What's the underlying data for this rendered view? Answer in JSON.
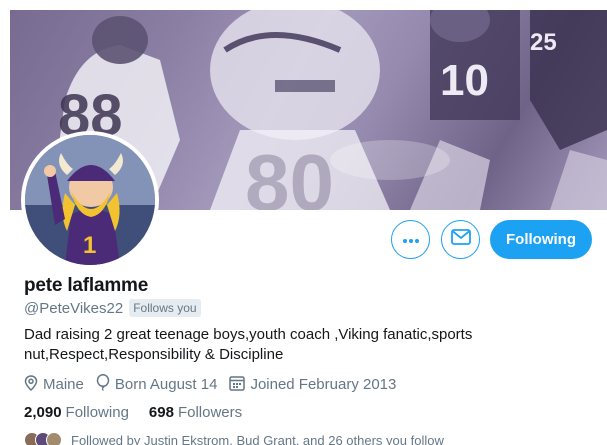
{
  "profile": {
    "display_name": "pete laflamme",
    "handle": "@PeteVikes22",
    "follows_you": "Follows you",
    "bio": "Dad raising 2 great teenage boys,youth coach ,Viking fanatic,sports nut,Respect,Responsibility & Discipline",
    "location": "Maine",
    "birthday": "Born August 14",
    "joined": "Joined February 2013",
    "following_count": "2,090",
    "following_label": "Following",
    "followers_count": "698",
    "followers_label": "Followers",
    "followed_by": "Followed by Justin Ekstrom, Bud Grant, and 26 others you follow"
  },
  "actions": {
    "following_button": "Following"
  },
  "icons": {
    "more": "more-icon",
    "message": "envelope-icon",
    "location": "location-pin-icon",
    "birthday": "balloon-icon",
    "calendar": "calendar-icon"
  },
  "colors": {
    "accent": "#1da1f2",
    "secondary_text": "#657786",
    "primary_text": "#14171a"
  }
}
